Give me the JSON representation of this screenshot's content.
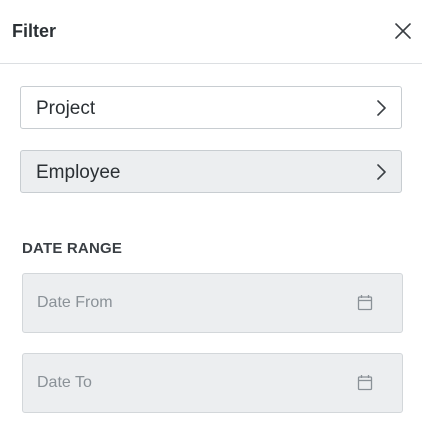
{
  "header": {
    "title": "Filter",
    "close_icon": "close-icon"
  },
  "filters": {
    "project": {
      "label": "Project",
      "icon": "chevron-right-icon"
    },
    "employee": {
      "label": "Employee",
      "icon": "chevron-right-icon"
    }
  },
  "date_range": {
    "heading": "DATE RANGE",
    "from": {
      "placeholder": "Date From",
      "value": "",
      "icon": "calendar-icon"
    },
    "to": {
      "placeholder": "Date To",
      "value": "",
      "icon": "calendar-icon"
    }
  },
  "colors": {
    "text": "#2b3034",
    "border": "#c8cdd1",
    "field_background": "#eceef0",
    "placeholder": "#8a9197"
  }
}
